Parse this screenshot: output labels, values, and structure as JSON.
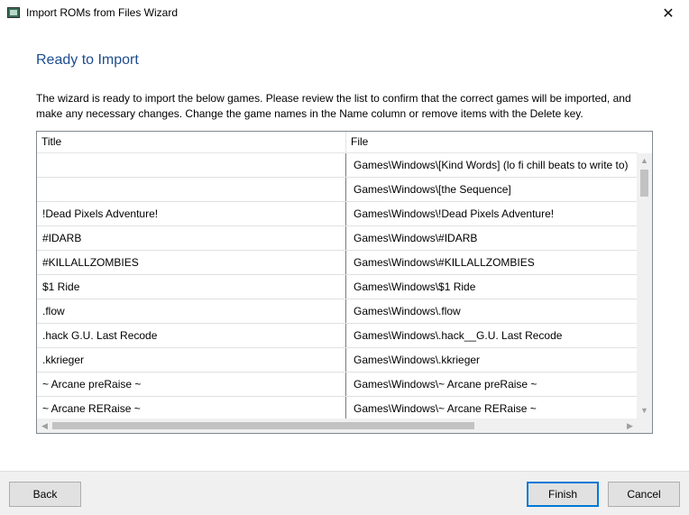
{
  "window": {
    "title": "Import ROMs from Files Wizard",
    "close_symbol": "✕"
  },
  "page": {
    "heading": "Ready to Import",
    "description": "The wizard is ready to import the below games. Please review the list to confirm that the correct games will be imported, and make any necessary changes. Change the game names in the Name column or remove items with the Delete key."
  },
  "grid": {
    "columns": {
      "title": "Title",
      "file": "File"
    },
    "rows": [
      {
        "title": "",
        "file": "Games\\Windows\\[Kind Words] (lo fi chill beats to write to)"
      },
      {
        "title": "",
        "file": "Games\\Windows\\[the Sequence]"
      },
      {
        "title": "!Dead Pixels Adventure!",
        "file": "Games\\Windows\\!Dead Pixels Adventure!"
      },
      {
        "title": "#IDARB",
        "file": "Games\\Windows\\#IDARB"
      },
      {
        "title": "#KILLALLZOMBIES",
        "file": "Games\\Windows\\#KILLALLZOMBIES"
      },
      {
        "title": "$1 Ride",
        "file": "Games\\Windows\\$1 Ride"
      },
      {
        "title": ".flow",
        "file": "Games\\Windows\\.flow"
      },
      {
        "title": ".hack G.U. Last Recode",
        "file": "Games\\Windows\\.hack__G.U. Last Recode"
      },
      {
        "title": ".kkrieger",
        "file": "Games\\Windows\\.kkrieger"
      },
      {
        "title": "~ Arcane preRaise ~",
        "file": "Games\\Windows\\~ Arcane preRaise ~"
      },
      {
        "title": "~ Arcane RERaise ~",
        "file": "Games\\Windows\\~ Arcane RERaise ~"
      }
    ]
  },
  "buttons": {
    "back": "Back",
    "finish": "Finish",
    "cancel": "Cancel"
  },
  "icons": {
    "scroll_up": "▲",
    "scroll_down": "▼",
    "scroll_left": "◀",
    "scroll_right": "▶"
  },
  "colors": {
    "heading": "#1e4c8f",
    "default_button_border": "#0078d7"
  }
}
